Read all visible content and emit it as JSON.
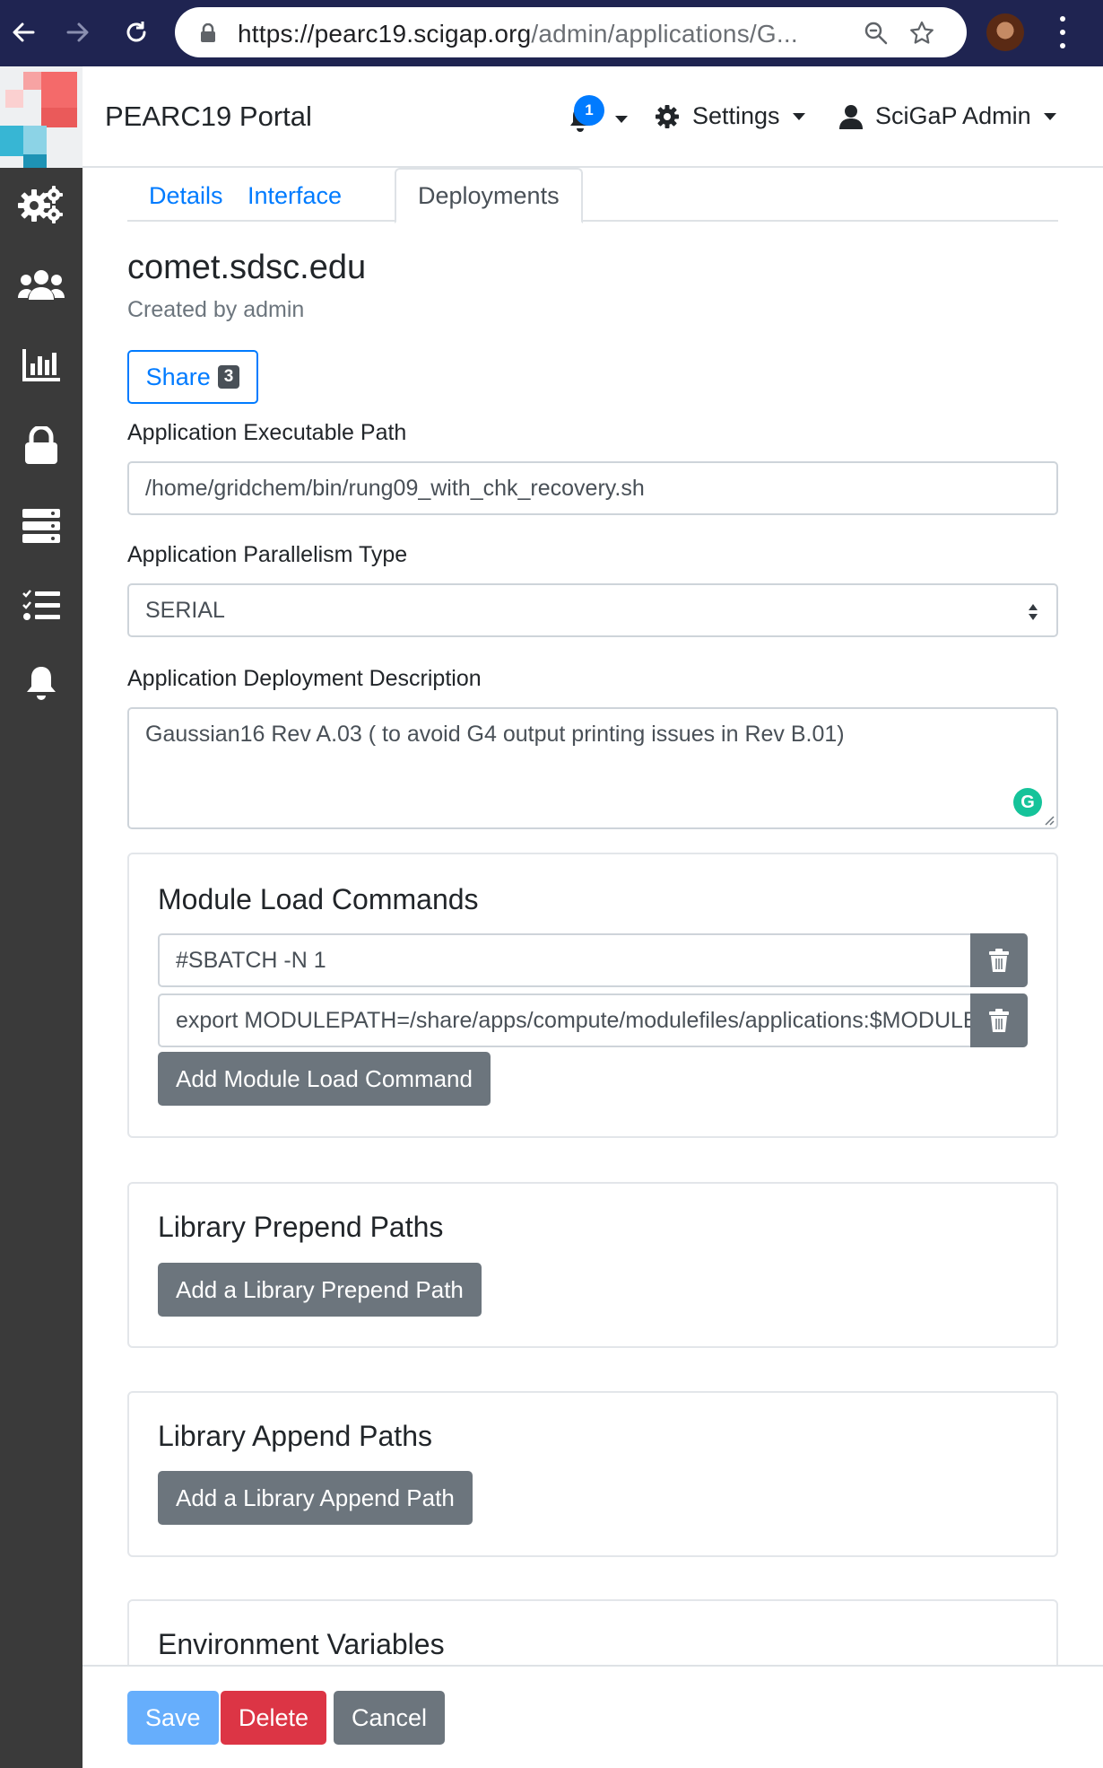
{
  "browser": {
    "url_domain": "https://pearc19.scigap.org",
    "url_path": "/admin/applications/G..."
  },
  "header": {
    "brand": "PEARC19 Portal",
    "notification_count": "1",
    "settings_label": "Settings",
    "user_label": "SciGaP Admin"
  },
  "sidebar": {
    "items": [
      {
        "icon": "cogs-icon"
      },
      {
        "icon": "users-icon"
      },
      {
        "icon": "chart-icon"
      },
      {
        "icon": "lock-icon"
      },
      {
        "icon": "server-icon"
      },
      {
        "icon": "tasks-icon"
      },
      {
        "icon": "bell-icon"
      }
    ]
  },
  "tabs": {
    "details": "Details",
    "interface": "Interface",
    "deployments": "Deployments",
    "active": "Deployments"
  },
  "deployment": {
    "title": "comet.sdsc.edu",
    "created_by": "Created by admin",
    "share_label": "Share",
    "share_count": "3",
    "exec_path_label": "Application Executable Path",
    "exec_path_value": "/home/gridchem/bin/rung09_with_chk_recovery.sh",
    "parallelism_label": "Application Parallelism Type",
    "parallelism_value": "SERIAL",
    "description_label": "Application Deployment Description",
    "description_value": "Gaussian16 Rev A.03 ( to avoid G4 output printing issues in Rev B.01)"
  },
  "module_load": {
    "title": "Module Load Commands",
    "commands": [
      "#SBATCH -N 1",
      "export MODULEPATH=/share/apps/compute/modulefiles/applications:$MODULEPATH"
    ],
    "add_label": "Add Module Load Command"
  },
  "library_prepend": {
    "title": "Library Prepend Paths",
    "add_label": "Add a Library Prepend Path"
  },
  "library_append": {
    "title": "Library Append Paths",
    "add_label": "Add a Library Append Path"
  },
  "env_vars": {
    "title": "Environment Variables"
  },
  "footer": {
    "save": "Save",
    "delete": "Delete",
    "cancel": "Cancel"
  },
  "colors": {
    "primary": "#007bff",
    "secondary": "#6c757d",
    "danger": "#dc3545",
    "sidebar": "#3a3a3a",
    "browser_bar": "#1f2451"
  }
}
